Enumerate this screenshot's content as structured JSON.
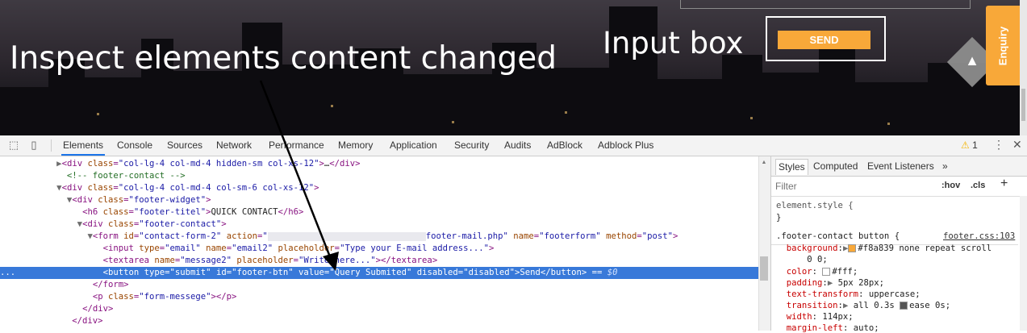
{
  "website": {
    "send_button": "SEND",
    "enquiry_tab": "Enquiry",
    "scroll_top_arrow": "▲"
  },
  "annotations": {
    "main_caption": "Inspect elements content changed",
    "input_caption": "Input box"
  },
  "devtools": {
    "tabs": [
      "Elements",
      "Console",
      "Sources",
      "Network",
      "Performance",
      "Memory",
      "Application",
      "Security",
      "Audits",
      "AdBlock",
      "Adblock Plus"
    ],
    "active_tab": "Elements",
    "warning_count": "1",
    "dom_ellipsis": "...",
    "styles_tabs": [
      "Styles",
      "Computed",
      "Event Listeners",
      "»"
    ],
    "filter_placeholder": "Filter",
    "hov": ":hov",
    "cls": ".cls",
    "element_style": "element.style {",
    "rule_selector": ".footer-contact button {",
    "rule_source": "footer.css:103",
    "properties": [
      {
        "name": "background",
        "value": "#f8a839 none repeat scroll",
        "swatch": "#f8a839"
      },
      {
        "name": "",
        "value": "0 0;"
      },
      {
        "name": "color",
        "value": "#fff;",
        "swatch": "#ffffff"
      },
      {
        "name": "padding",
        "value": "5px 28px;"
      },
      {
        "name": "text-transform",
        "value": "uppercase;"
      },
      {
        "name": "transition",
        "value": "all 0.3s ",
        "extra": "ease 0s;"
      },
      {
        "name": "width",
        "value": "114px;"
      },
      {
        "name": "margin-left",
        "value": "auto;"
      }
    ]
  },
  "colors": {
    "accent": "#f8a839",
    "selection": "#3879d9"
  }
}
